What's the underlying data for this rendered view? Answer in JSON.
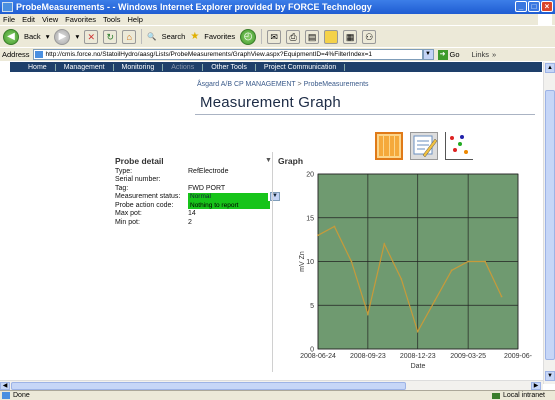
{
  "window": {
    "title": "ProbeMeasurements - - Windows Internet Explorer provided by FORCE Technology"
  },
  "menu": [
    "File",
    "Edit",
    "View",
    "Favorites",
    "Tools",
    "Help"
  ],
  "toolbar": {
    "back_label": "Back",
    "search_label": "Search",
    "favorites_label": "Favorites"
  },
  "address": {
    "label": "Address",
    "url": "http://cmis.force.no/StatoilHydro/aasg/Lists/ProbeMeasurements/GraphView.aspx?EquipmentID=4%FilterIndex=1",
    "go_label": "Go",
    "links_label": "Links"
  },
  "nav": {
    "items": [
      "Home",
      "Management",
      "Monitoring",
      "Actions",
      "Other Tools",
      "Project Communication"
    ]
  },
  "breadcrumb": {
    "root": "Åsgard A/B CP MANAGEMENT",
    "separator": ">",
    "current": "ProbeMeasurements"
  },
  "page": {
    "title": "Measurement Graph"
  },
  "probe": {
    "heading": "Probe detail",
    "rows": [
      {
        "label": "Type:",
        "value": "RefElectrode"
      },
      {
        "label": "Serial number:",
        "value": ""
      },
      {
        "label": "Tag:",
        "value": "FWD PORT"
      },
      {
        "label": "Measurement status:",
        "value": "Normal"
      },
      {
        "label": "Probe action code:",
        "value": "Nothing to report"
      },
      {
        "label": "Max pot:",
        "value": "14"
      },
      {
        "label": "Min pot:",
        "value": "2"
      }
    ]
  },
  "graph": {
    "heading": "Graph"
  },
  "chart_data": {
    "type": "line",
    "xlabel": "Date",
    "ylabel": "mV Zn",
    "x_ticks": [
      "2008-06-24",
      "2008-09-23",
      "2008-12-23",
      "2009-03-25",
      "2009-06-"
    ],
    "y_ticks": [
      "0",
      "5",
      "10",
      "15",
      "20"
    ],
    "ylim": [
      0,
      20
    ],
    "grid": true,
    "background_color": "#6f9a70",
    "line_color": "#c79a3a",
    "series": [
      {
        "x": [
          "2008-06-24",
          "2008-07-24",
          "2008-08-24",
          "2008-09-23",
          "2008-10-23",
          "2008-11-23",
          "2008-12-23",
          "2009-01-23",
          "2009-02-23",
          "2009-03-25",
          "2009-04-25",
          "2009-05-25"
        ],
        "values": [
          13,
          14,
          10,
          4,
          12,
          8,
          2,
          5.5,
          9,
          10,
          10,
          6
        ]
      }
    ]
  },
  "status": {
    "text": "Done",
    "zone": "Local intranet"
  }
}
